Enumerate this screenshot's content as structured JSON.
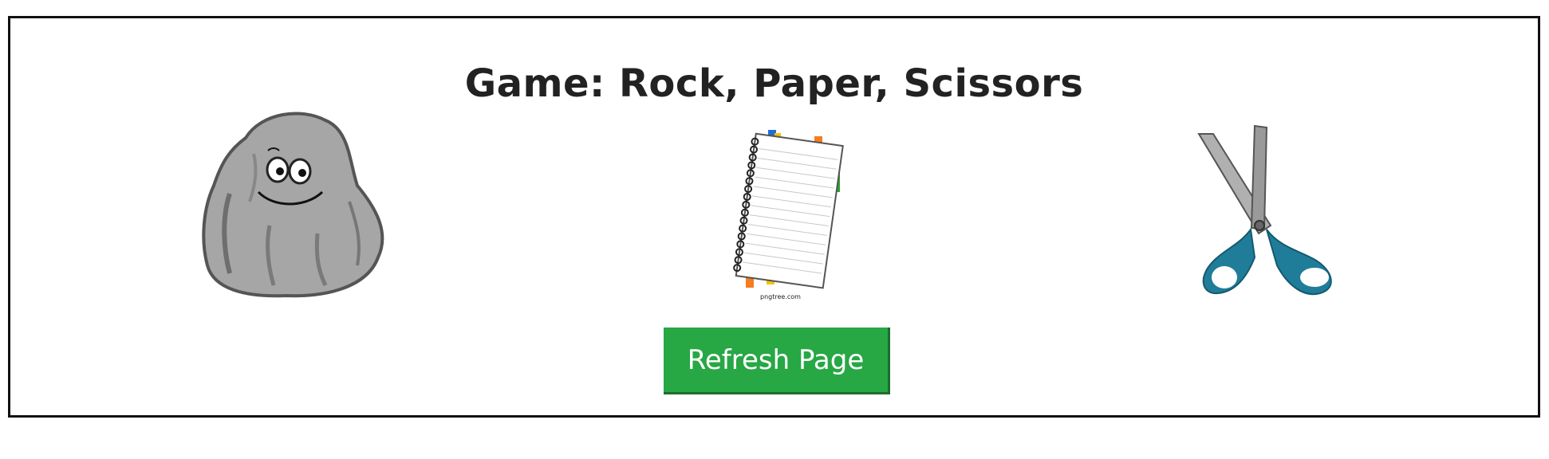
{
  "page": {
    "title": "Game: Rock, Paper, Scissors"
  },
  "choices": [
    {
      "name": "rock",
      "icon": "rock-cartoon-icon"
    },
    {
      "name": "paper",
      "icon": "notebook-paper-icon",
      "watermark": "pngtree.com"
    },
    {
      "name": "scissors",
      "icon": "scissors-icon"
    }
  ],
  "actions": {
    "refresh_label": "Refresh Page"
  },
  "colors": {
    "button": "#28a745",
    "scissors_handle": "#1f7d99",
    "rock": "#9a9a9a",
    "border": "#111111"
  }
}
